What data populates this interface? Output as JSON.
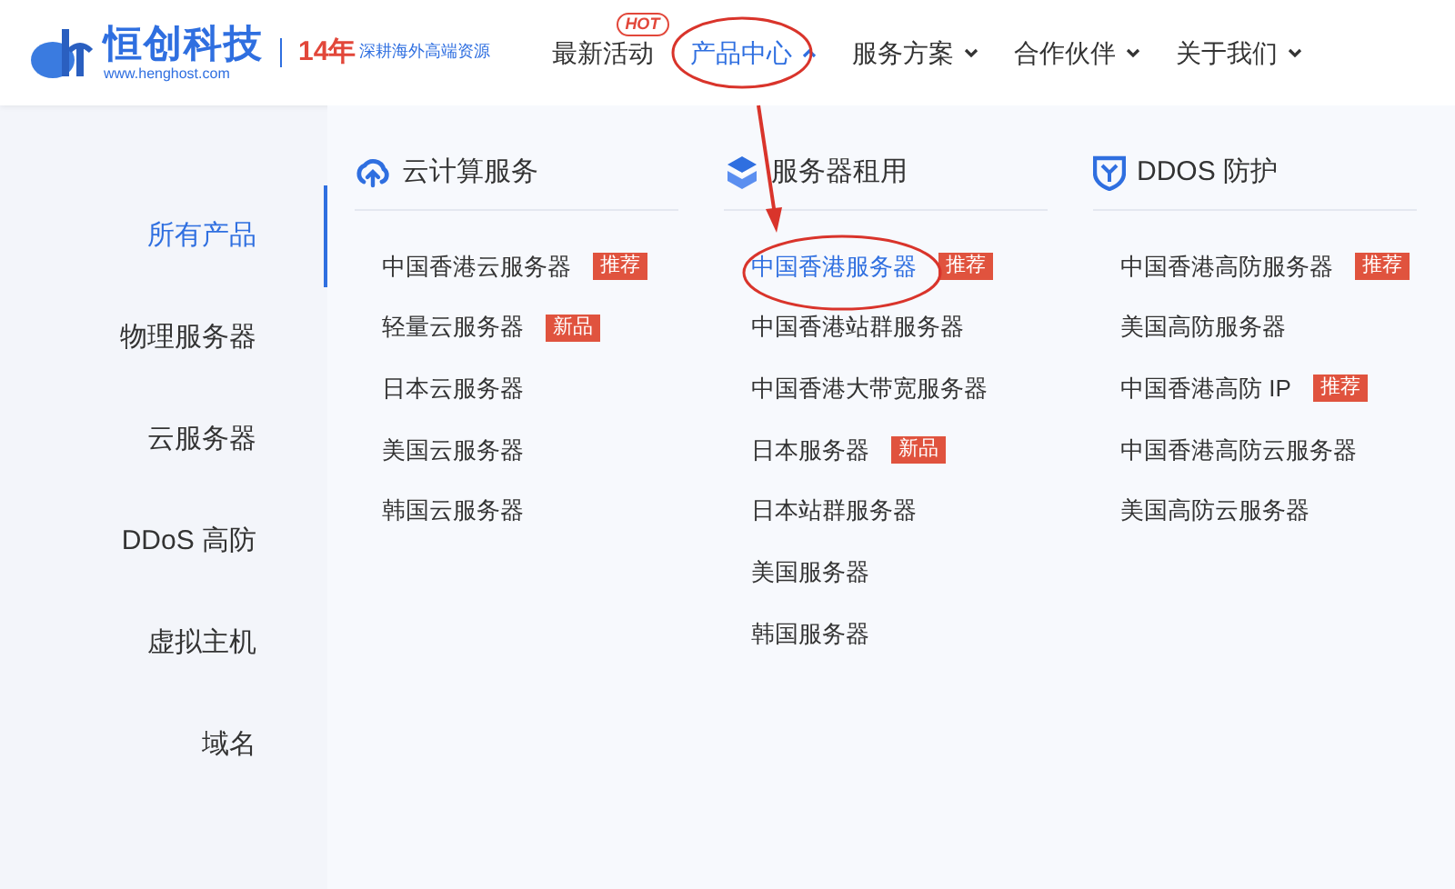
{
  "header": {
    "logo": {
      "name": "恒创科技",
      "url": "www.henghost.com",
      "years": "14年",
      "slogan": "深耕海外高端资源"
    },
    "nav": [
      {
        "badge": "HOT",
        "label": "最新活动",
        "selected": false
      },
      {
        "label": "产品中心",
        "selected": true,
        "caret": true
      },
      {
        "label": "服务方案",
        "selected": false,
        "caret": true
      },
      {
        "label": "合作伙伴",
        "selected": false,
        "caret": true
      },
      {
        "label": "关于我们",
        "selected": false,
        "caret": true
      }
    ]
  },
  "sidebar": {
    "items": [
      {
        "label": "所有产品",
        "selected": true
      },
      {
        "label": "物理服务器",
        "selected": false
      },
      {
        "label": "云服务器",
        "selected": false
      },
      {
        "label": "DDoS 高防",
        "selected": false
      },
      {
        "label": "虚拟主机",
        "selected": false
      },
      {
        "label": "域名",
        "selected": false
      }
    ]
  },
  "columns": [
    {
      "kind": "cloud",
      "title": "云计算服务",
      "items": [
        {
          "label": "中国香港云服务器",
          "badge": "推荐",
          "selected": false
        },
        {
          "label": "轻量云服务器",
          "badge": "新品",
          "selected": false
        },
        {
          "label": "日本云服务器",
          "selected": false
        },
        {
          "label": "美国云服务器",
          "selected": false
        },
        {
          "label": "韩国云服务器",
          "selected": false
        }
      ]
    },
    {
      "kind": "server",
      "title": "服务器租用",
      "items": [
        {
          "label": "中国香港服务器",
          "badge": "推荐",
          "selected": true
        },
        {
          "label": "中国香港站群服务器",
          "selected": false
        },
        {
          "label": "中国香港大带宽服务器",
          "selected": false
        },
        {
          "label": "日本服务器",
          "badge": "新品",
          "selected": false
        },
        {
          "label": "日本站群服务器",
          "selected": false
        },
        {
          "label": "美国服务器",
          "selected": false
        },
        {
          "label": "韩国服务器",
          "selected": false
        }
      ]
    },
    {
      "kind": "shield",
      "title": "DDOS 防护",
      "items": [
        {
          "label": "中国香港高防服务器",
          "badge": "推荐",
          "selected": false
        },
        {
          "label": "美国高防服务器",
          "selected": false
        },
        {
          "label": "中国香港高防 IP",
          "badge": "推荐",
          "selected": false
        },
        {
          "label": "中国香港高防云服务器",
          "selected": false
        },
        {
          "label": "美国高防云服务器",
          "selected": false
        }
      ]
    }
  ]
}
